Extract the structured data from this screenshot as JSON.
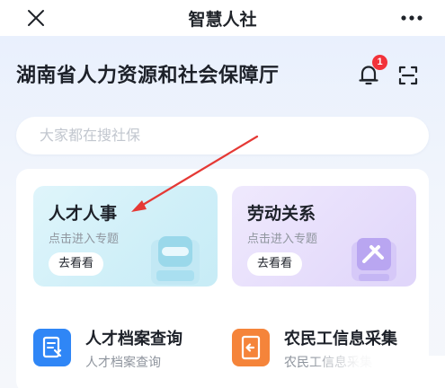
{
  "app": {
    "title": "智慧人社"
  },
  "header": {
    "org_title": "湖南省人力资源和社会保障厅",
    "notification_count": "1"
  },
  "search": {
    "placeholder": "大家都在搜社保"
  },
  "topics": [
    {
      "title": "人才人事",
      "subtitle": "点击进入专题",
      "action": "去看看"
    },
    {
      "title": "劳动关系",
      "subtitle": "点击进入专题",
      "action": "去看看"
    }
  ],
  "services": [
    {
      "title": "人才档案查询",
      "subtitle": "人才档案查询"
    },
    {
      "title": "农民工信息采集",
      "subtitle": "农民工信息采集"
    }
  ],
  "icons": {
    "close": "close-icon",
    "more": "more-icon",
    "bell": "bell-icon",
    "scan": "scan-icon"
  },
  "colors": {
    "accent_blue": "#2f86f6",
    "accent_orange": "#f5843a",
    "badge_red": "#f2323a",
    "annotation_arrow": "#e53935"
  }
}
